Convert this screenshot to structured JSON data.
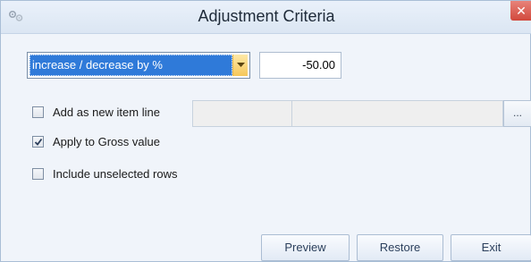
{
  "window": {
    "title": "Adjustment Criteria",
    "app_icon": "gears-icon",
    "close_icon": "close-icon",
    "close_glyph": "✕"
  },
  "criteria": {
    "adjustment_type": "increase / decrease by %",
    "dropdown_icon": "chevron-down-icon",
    "value": "-50.00"
  },
  "options": {
    "add_as_new_item_line": {
      "label": "Add as new item line",
      "checked": false
    },
    "apply_to_gross_value": {
      "label": "Apply to Gross value",
      "checked": true
    },
    "include_unselected_rows": {
      "label": "Include unselected rows",
      "checked": false
    }
  },
  "item_line": {
    "field1_value": "",
    "field2_value": "",
    "browse_label": "..."
  },
  "buttons": {
    "preview": "Preview",
    "restore": "Restore",
    "exit": "Exit"
  },
  "colors": {
    "selection": "#2f7ad9",
    "window_bg": "#f0f4fa",
    "close_red": "#d2483c",
    "dropdown_amber": "#f6c75a"
  }
}
